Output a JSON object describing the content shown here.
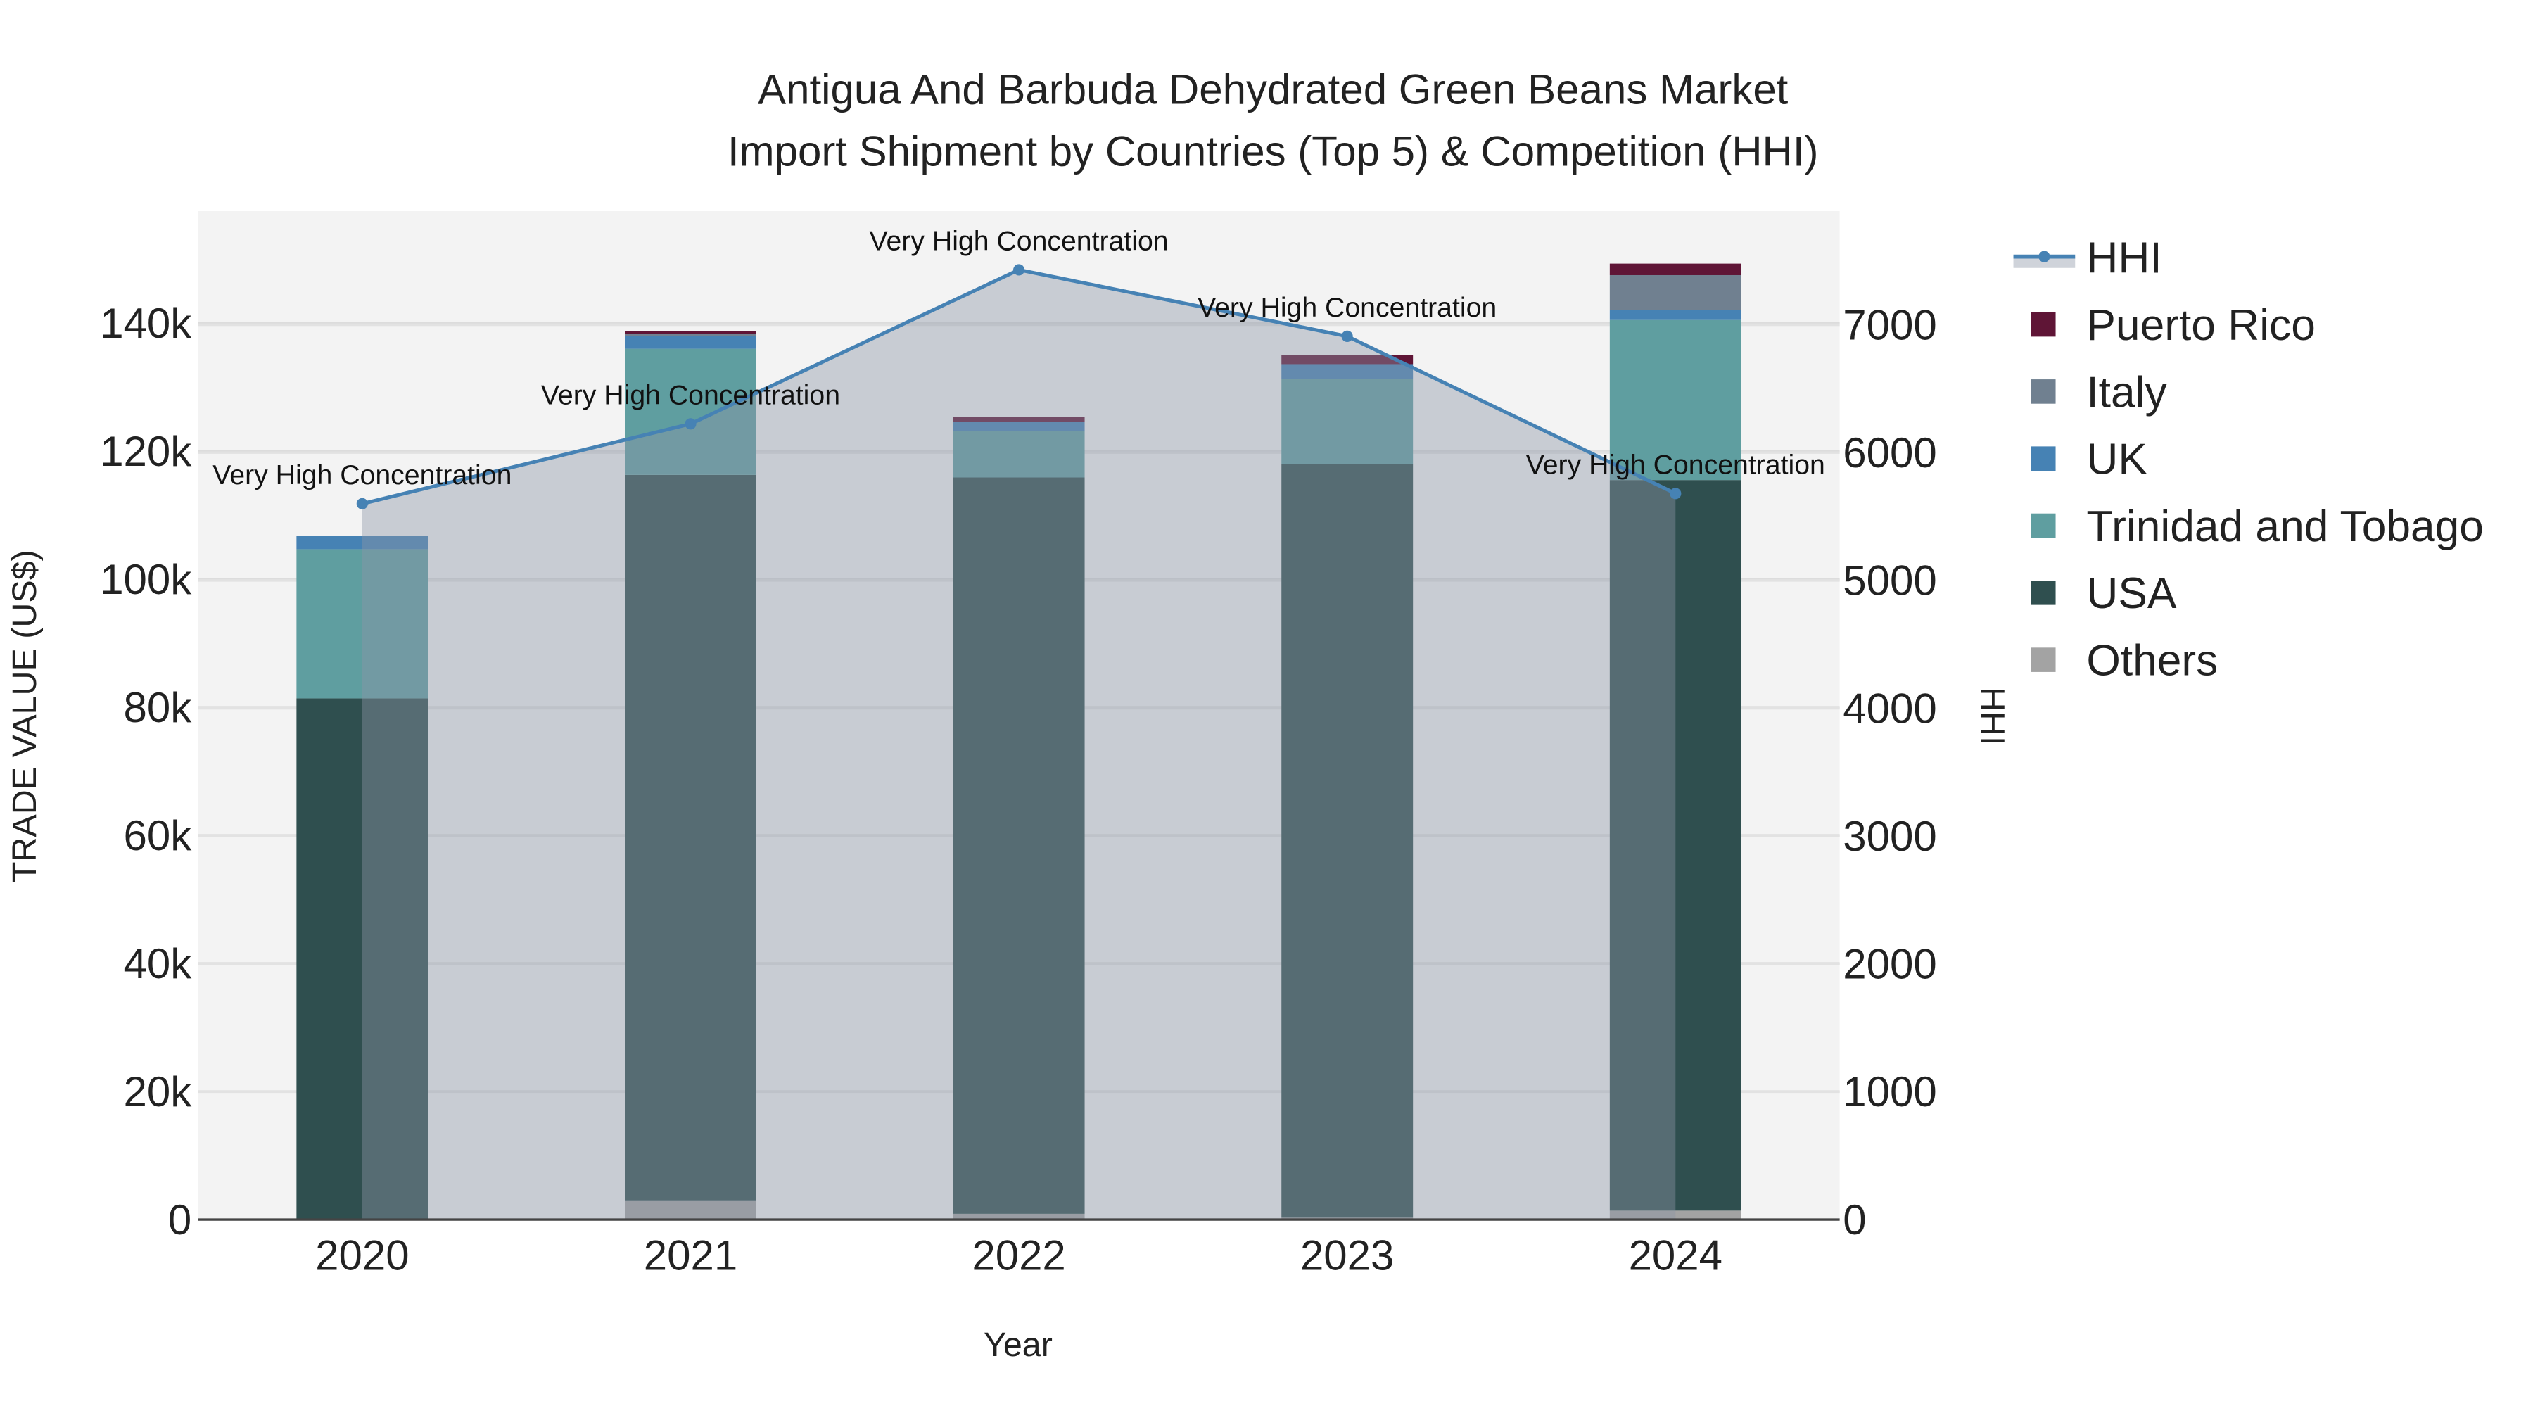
{
  "chart_data": {
    "type": "bar",
    "title": [
      "Antigua And Barbuda Dehydrated Green Beans Market",
      "Import Shipment by Countries (Top 5) & Competition (HHI)"
    ],
    "xlabel": "Year",
    "ylabel": "TRADE VALUE (US$)",
    "y2label": "HHI",
    "categories": [
      "2020",
      "2021",
      "2022",
      "2023",
      "2024"
    ],
    "ylim": [
      0,
      157000
    ],
    "y2lim": [
      0,
      7880
    ],
    "yticks": [
      0,
      20000,
      40000,
      60000,
      80000,
      100000,
      120000,
      140000
    ],
    "ytick_labels": [
      "0",
      "20k",
      "40k",
      "60k",
      "80k",
      "100k",
      "120k",
      "140k"
    ],
    "y2ticks": [
      0,
      1000,
      2000,
      3000,
      4000,
      5000,
      6000,
      7000
    ],
    "y2tick_labels": [
      "0",
      "1000",
      "2000",
      "3000",
      "4000",
      "5000",
      "6000",
      "7000"
    ],
    "stacked": true,
    "series": [
      {
        "name": "Others",
        "color": "#a3a3a3",
        "values": [
          0,
          3000,
          900,
          300,
          1400
        ]
      },
      {
        "name": "USA",
        "color": "#2f4f4f",
        "values": [
          81400,
          113300,
          115000,
          117700,
          114100
        ]
      },
      {
        "name": "Trinidad and Tobago",
        "color": "#5f9ea0",
        "values": [
          23300,
          19700,
          7200,
          13300,
          25000
        ]
      },
      {
        "name": "UK",
        "color": "#4682b4",
        "values": [
          2100,
          2000,
          1500,
          2300,
          1600
        ]
      },
      {
        "name": "Italy",
        "color": "#708090",
        "values": [
          0,
          300,
          0,
          0,
          5400
        ]
      },
      {
        "name": "Puerto Rico",
        "color": "#5f1536",
        "values": [
          0,
          500,
          800,
          1400,
          1800
        ]
      }
    ],
    "line": {
      "name": "HHI",
      "color": "#4682b4",
      "values": [
        5600,
        6225,
        7430,
        6910,
        5680
      ]
    },
    "annotations": [
      "Very High Concentration",
      "Very High Concentration",
      "Very High Concentration",
      "Very High Concentration",
      "Very High Concentration"
    ],
    "legend": [
      "HHI",
      "Puerto Rico",
      "Italy",
      "UK",
      "Trinidad and Tobago",
      "USA",
      "Others"
    ],
    "legend_placement": "right",
    "grid": true
  }
}
